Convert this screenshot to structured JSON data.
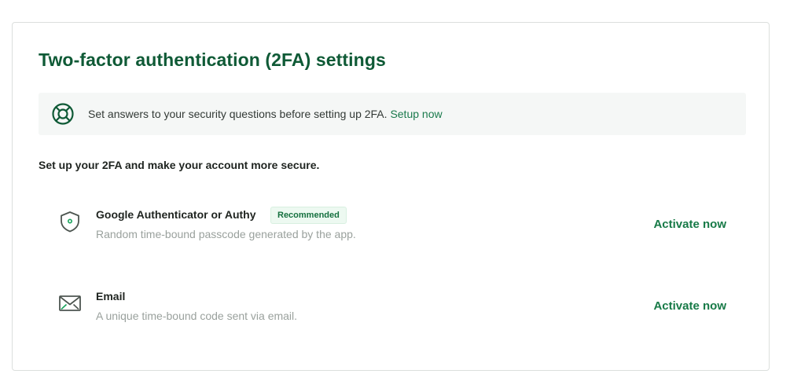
{
  "page": {
    "title": "Two-factor authentication (2FA) settings"
  },
  "notice": {
    "icon": "lifebuoy-icon",
    "text": "Set answers to your security questions before setting up 2FA.",
    "link_label": "Setup now"
  },
  "intro": {
    "text": "Set up your 2FA and make your account more secure."
  },
  "methods": [
    {
      "icon": "shield-icon",
      "name": "Google Authenticator or Authy",
      "badge": "Recommended",
      "description": "Random time-bound passcode generated by the app.",
      "action_label": "Activate now"
    },
    {
      "icon": "envelope-icon",
      "name": "Email",
      "description": "A unique time-bound code sent via email.",
      "action_label": "Activate now"
    }
  ],
  "colors": {
    "brand_green": "#0f5a36",
    "link_green": "#1a7a4c",
    "badge_bg": "#edf9f1"
  }
}
